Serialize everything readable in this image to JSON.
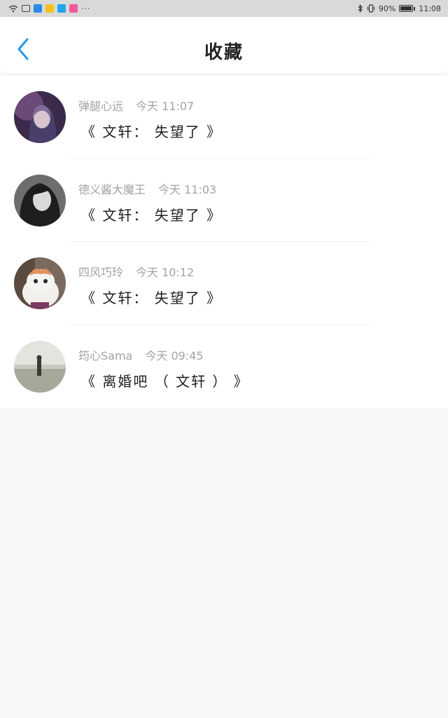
{
  "status_bar": {
    "battery_percent": "90%",
    "clock": "11:08",
    "overflow": "···"
  },
  "header": {
    "title": "收藏",
    "back_icon": "chevron-left-icon",
    "accent_color": "#1e9be8"
  },
  "favorites": [
    {
      "user": "弹腿心远",
      "time": "今天 11:07",
      "title": "《 文轩： 失望了 》"
    },
    {
      "user": "德义酱大魔王",
      "time": "今天 11:03",
      "title": "《 文轩： 失望了 》"
    },
    {
      "user": "四风巧玲",
      "time": "今天 10:12",
      "title": "《 文轩： 失望了 》"
    },
    {
      "user": "筠心Sama",
      "time": "今天 09:45",
      "title": "《 离婚吧 （ 文轩 ） 》"
    }
  ]
}
